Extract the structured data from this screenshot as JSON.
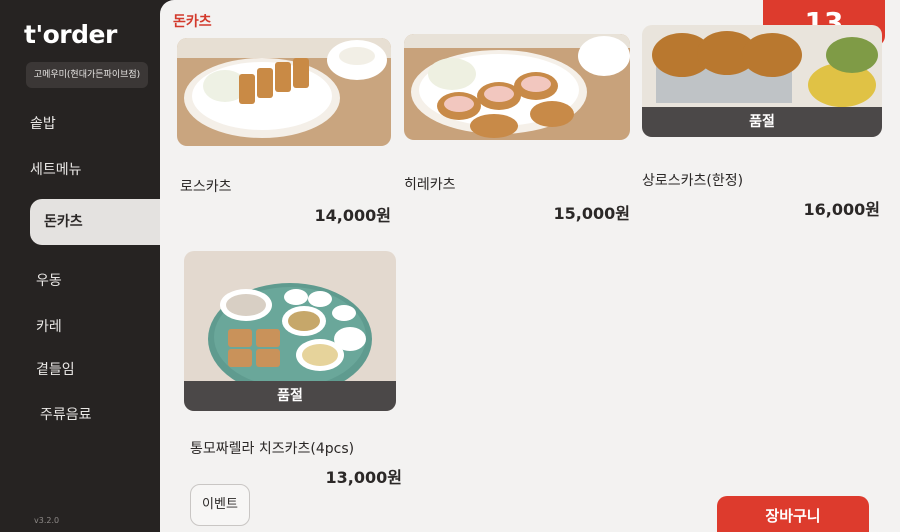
{
  "app": {
    "logo": "t'order",
    "store_name": "고메우미(현대가든파이브점)",
    "version": "v3.2.0"
  },
  "sidebar": {
    "items": [
      {
        "label": "솥밥",
        "active": false
      },
      {
        "label": "세트메뉴",
        "active": false
      },
      {
        "label": "돈카츠",
        "active": true
      },
      {
        "label": "우동",
        "active": false
      },
      {
        "label": "카레",
        "active": false
      },
      {
        "label": "곁들임",
        "active": false
      },
      {
        "label": "주류음료",
        "active": false
      }
    ]
  },
  "header": {
    "category_title": "돈카츠",
    "table_number": "13"
  },
  "menu": [
    {
      "name": "로스카츠",
      "price": "14,000원",
      "sold_out": false
    },
    {
      "name": "히레카츠",
      "price": "15,000원",
      "sold_out": false
    },
    {
      "name": "상로스카츠(한정)",
      "price": "16,000원",
      "sold_out": true,
      "sold_out_label": "품절"
    },
    {
      "name": "통모짜렐라 치즈카츠(4pcs)",
      "price": "13,000원",
      "sold_out": true,
      "sold_out_label": "품절"
    }
  ],
  "footer": {
    "event_label": "이벤트",
    "cart_label": "장바구니"
  },
  "colors": {
    "accent": "#dd3b2d",
    "sidebar_bg": "#262322",
    "panel_bg": "#f3f2f1"
  }
}
